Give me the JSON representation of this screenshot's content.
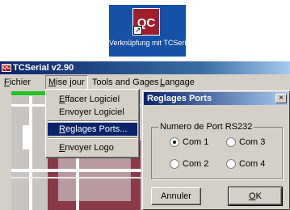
{
  "desktop": {
    "shortcut_logo": "QC",
    "shortcut_label": "Verknüpfung mit TCSerial.exe"
  },
  "window": {
    "title": "TCSerial v2.90",
    "icon_text": "QC"
  },
  "menubar": {
    "fichier": {
      "label": "Fichier",
      "accel": "F",
      "rest": "ichier"
    },
    "mise_jour": {
      "label": "Mise jour",
      "accel": "M",
      "rest": "ise jour"
    },
    "tools": {
      "label": "Tools and Gages"
    },
    "langage": {
      "label": "Langage",
      "accel": "L",
      "rest": "angage"
    }
  },
  "dropdown": {
    "items": [
      {
        "label": "Effacer Logiciel",
        "accel": "E",
        "rest": "ffacer Logiciel"
      },
      {
        "label": "Envoyer Logiciel"
      },
      {
        "label": "Reglages Ports...",
        "accel": "R",
        "rest": "eglages Ports..."
      },
      {
        "label": "Envoyer Logo",
        "accel": "E",
        "rest": "nvoyer Logo"
      }
    ],
    "selected": "Reglages Ports..."
  },
  "dialog": {
    "title": "Reglages Ports",
    "close_glyph": "×",
    "group_label": "Numero de Port RS232",
    "ports": [
      {
        "label": "Com 1",
        "selected": true
      },
      {
        "label": "Com 3",
        "selected": false
      },
      {
        "label": "Com 2",
        "selected": false
      },
      {
        "label": "Com 4",
        "selected": false
      }
    ],
    "cancel_label": "Annuler",
    "ok_label": "OK"
  },
  "colors": {
    "desktop_blue": "#1651a8",
    "brand_red": "#a01e2a",
    "titlebar": "#0a246a",
    "progress": "#22c322",
    "menu_highlight": "#0a246a"
  }
}
